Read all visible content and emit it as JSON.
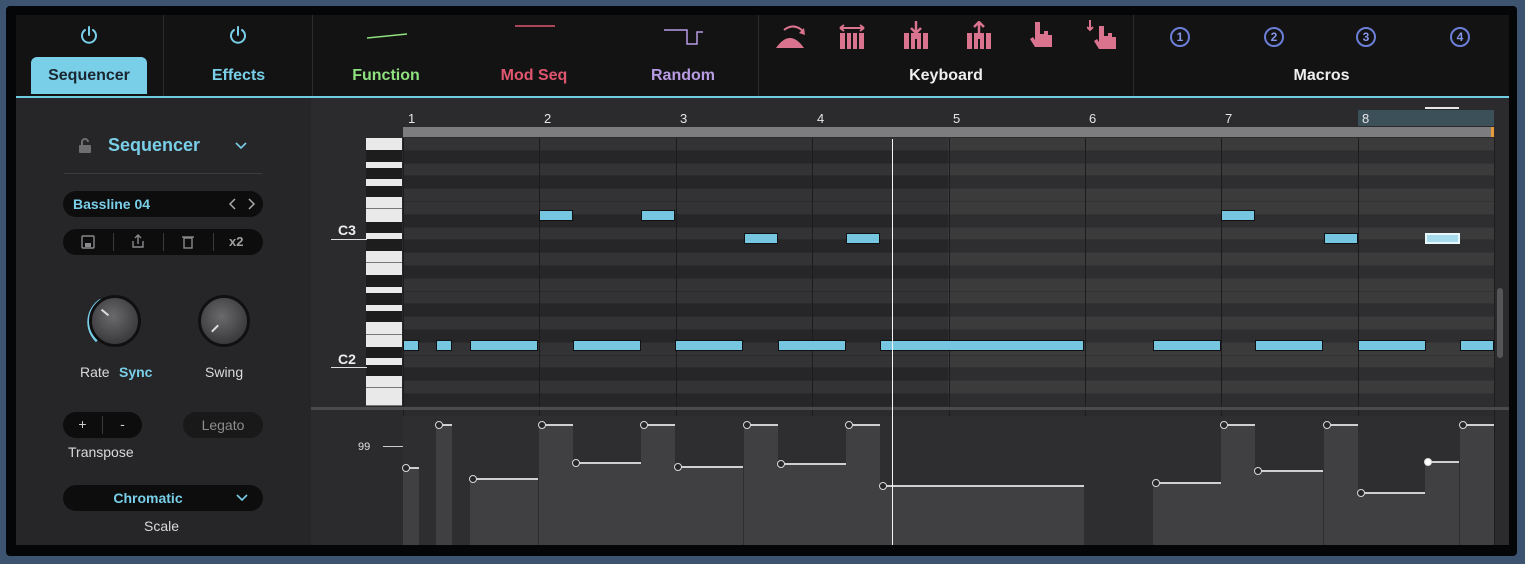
{
  "top_tabs": {
    "sequencer_label": "Sequencer",
    "effects_label": "Effects",
    "function_label": "Function",
    "modseq_label": "Mod Seq",
    "random_label": "Random",
    "keyboard_label": "Keyboard",
    "macros_label": "Macros",
    "macro_numbers": [
      "1",
      "2",
      "3",
      "4"
    ]
  },
  "colors": {
    "accent": "#79cfe8",
    "function": "#8fe07e",
    "modseq": "#e0566f",
    "random": "#b79be3",
    "keyboard_icon": "#d9738e",
    "macros": "#8596ea",
    "note": "#76c6e1"
  },
  "left_panel": {
    "mode_title": "Sequencer",
    "preset_name": "Bassline 04",
    "x2_label": "x2",
    "rate_label": "Rate",
    "rate_sync": "Sync",
    "swing_label": "Swing",
    "transpose_plus": "+",
    "transpose_minus": "-",
    "legato_label": "Legato",
    "transpose_label": "Transpose",
    "scale_value": "Chromatic",
    "scale_label": "Scale"
  },
  "grid": {
    "bars": [
      "1",
      "2",
      "3",
      "4",
      "5",
      "6",
      "7",
      "8"
    ],
    "octave_labels": [
      "C3",
      "C2"
    ],
    "velocity_marker": "99"
  }
}
